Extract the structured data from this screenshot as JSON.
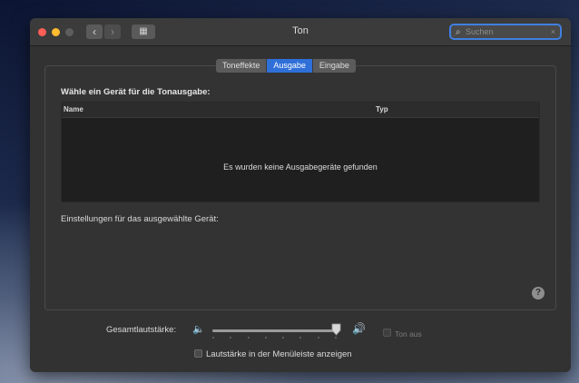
{
  "window": {
    "title": "Ton",
    "nav": {
      "back_icon": "‹",
      "forward_icon": "›",
      "grid_icon": "▦"
    },
    "search": {
      "placeholder": "Suchen",
      "icon": "search-icon",
      "clear_icon": "×"
    }
  },
  "tabs": [
    {
      "label": "Toneffekte",
      "active": false
    },
    {
      "label": "Ausgabe",
      "active": true
    },
    {
      "label": "Eingabe",
      "active": false
    }
  ],
  "output": {
    "heading": "Wähle ein Gerät für die Tonausgabe:",
    "columns": {
      "name": "Name",
      "type": "Typ"
    },
    "empty_message": "Es wurden keine Ausgabegeräte gefunden",
    "settings_label": "Einstellungen für das ausgewählte Gerät:"
  },
  "help": {
    "label": "?"
  },
  "volume": {
    "label": "Gesamtlautstärke:",
    "level": 1.0,
    "mute_label": "Ton aus",
    "mute_checked": false,
    "mute_enabled": false,
    "low_icon": "speaker-low-icon",
    "high_icon": "speaker-high-icon"
  },
  "menubar_option": {
    "label": "Lautstärke in der Menüleiste anzeigen",
    "checked": false
  },
  "colors": {
    "accent": "#2f6fd8",
    "window": "#323232",
    "table": "#1f1f1f"
  }
}
